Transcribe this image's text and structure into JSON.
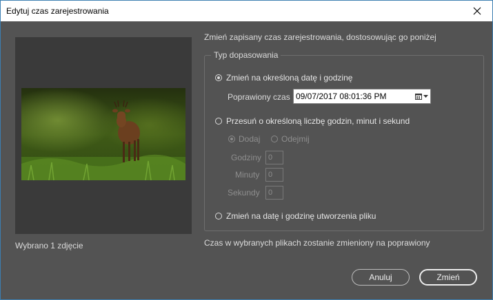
{
  "window": {
    "title": "Edytuj czas zarejestrowania"
  },
  "preview": {
    "selected_count": "Wybrano 1 zdjęcie"
  },
  "instruction": "Zmień zapisany czas zarejestrowania, dostosowując go poniżej",
  "group": {
    "legend": "Typ dopasowania",
    "options": {
      "specific": {
        "label": "Zmień na określoną datę i godzinę",
        "checked": true
      },
      "shift": {
        "label": "Przesuń o określoną liczbę godzin, minut i sekund",
        "checked": false
      },
      "file_date": {
        "label": "Zmień na datę i godzinę utworzenia pliku",
        "checked": false
      }
    },
    "corrected_time": {
      "label": "Poprawiony czas",
      "value": "09/07/2017  08:01:36 PM"
    },
    "shift": {
      "add_label": "Dodaj",
      "subtract_label": "Odejmij",
      "hours_label": "Godziny",
      "hours_value": "0",
      "minutes_label": "Minuty",
      "minutes_value": "0",
      "seconds_label": "Sekundy",
      "seconds_value": "0"
    }
  },
  "footnote": "Czas w wybranych plikach zostanie zmieniony na poprawiony",
  "buttons": {
    "cancel": "Anuluj",
    "ok": "Zmień"
  },
  "colors": {
    "dialog_bg": "#535353",
    "preview_bg": "#3a3a3a",
    "titlebar_bg": "#ffffff",
    "text": "#dcdcdc",
    "disabled_text": "#8e8e8e"
  },
  "icons": {
    "close": "close-icon",
    "calendar": "calendar-icon",
    "dropdown": "chevron-down-icon"
  }
}
